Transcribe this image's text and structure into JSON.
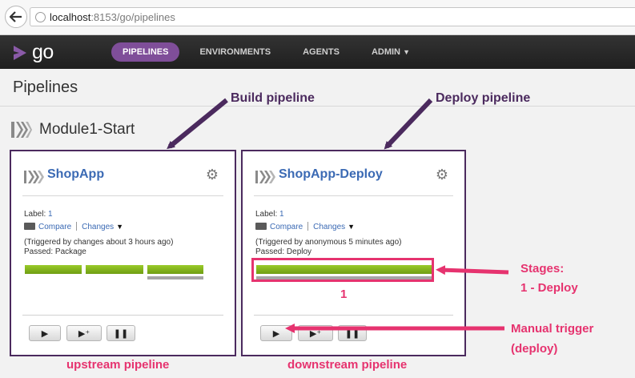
{
  "browser": {
    "url_host": "localhost",
    "url_rest": ":8153/go/pipelines"
  },
  "header": {
    "logo_text": "go",
    "nav": [
      {
        "label": "PIPELINES",
        "active": true
      },
      {
        "label": "ENVIRONMENTS",
        "active": false
      },
      {
        "label": "AGENTS",
        "active": false
      },
      {
        "label": "ADMIN",
        "active": false
      }
    ],
    "accent_color": "#7f4e99"
  },
  "page": {
    "title": "Pipelines",
    "group_name": "Module1-Start"
  },
  "pipelines": [
    {
      "name": "ShopApp",
      "label_text": "Label:",
      "label_value": "1",
      "compare": "Compare",
      "changes": "Changes",
      "triggered": "(Triggered by changes about 3 hours ago)",
      "passed": "Passed: Package",
      "stage_count": 3
    },
    {
      "name": "ShopApp-Deploy",
      "label_text": "Label:",
      "label_value": "1",
      "compare": "Compare",
      "changes": "Changes",
      "triggered": "(Triggered by anonymous 5 minutes ago)",
      "passed": "Passed: Deploy",
      "stage_count": 1
    }
  ],
  "annotations": {
    "build_pipeline": "Build pipeline",
    "deploy_pipeline": "Deploy pipeline",
    "stages_line1": "Stages:",
    "stages_line2": "1 - Deploy",
    "stage_number": "1",
    "manual_trigger_line1": "Manual trigger",
    "manual_trigger_line2": "(deploy)",
    "upstream": "upstream pipeline",
    "downstream": "downstream pipeline",
    "colors": {
      "purple": "#4b2a5e",
      "pink": "#e6336f",
      "stage_green": "#8ab81e"
    }
  },
  "icons": [
    "back-arrow-icon",
    "globe-icon",
    "go-logo-icon",
    "pipeline-group-icon",
    "pipeline-icon",
    "gear-icon",
    "compare-icon",
    "play-icon",
    "play-with-options-icon",
    "pause-icon"
  ]
}
